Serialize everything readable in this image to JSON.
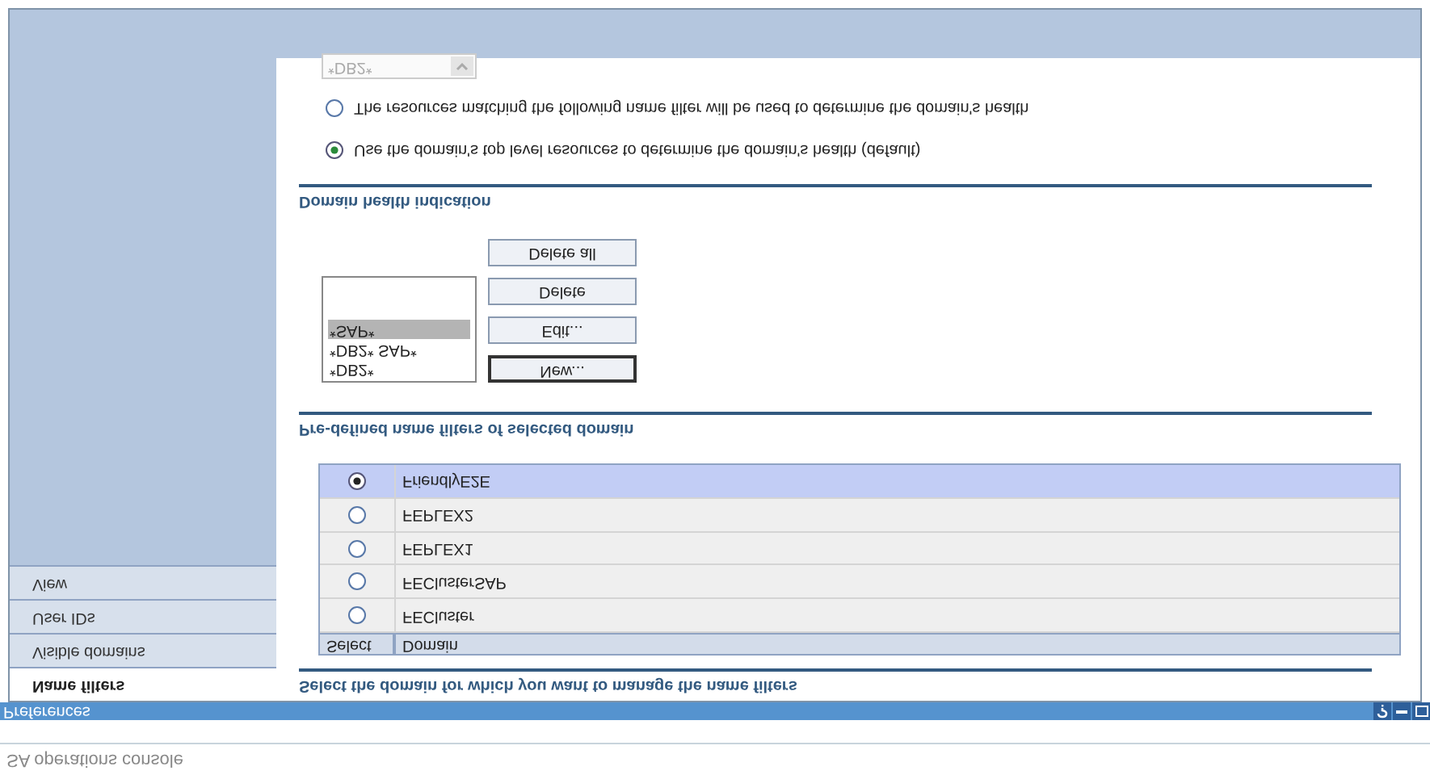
{
  "health_section": {
    "filter_combo": {
      "value": "*DB2*",
      "disabled": true
    },
    "options": [
      {
        "label": "The resources matching the following name filter will be used to determine the domain's health",
        "selected": false
      },
      {
        "label": "Use the domain's top level resources to determine the domain's health (default)",
        "selected": true
      }
    ],
    "heading": "Domain health indication"
  },
  "filters_section": {
    "buttons": [
      {
        "label": "Delete all",
        "focused": false
      },
      {
        "label": "Delete",
        "focused": false
      },
      {
        "label": "Edit...",
        "focused": false
      },
      {
        "label": "New...",
        "focused": true
      }
    ],
    "filters": [
      {
        "label": "*SAP*",
        "selected": true
      },
      {
        "label": "*DB2* SAP*",
        "selected": false
      },
      {
        "label": "*DB2*",
        "selected": false
      }
    ],
    "heading": "Pre-defined name filters of selected domain"
  },
  "domain_section": {
    "table": {
      "rows": [
        {
          "domain": "FriendlyE2E",
          "selected": true
        },
        {
          "domain": "FEPLEX2",
          "selected": false
        },
        {
          "domain": "FEPLEX1",
          "selected": false
        },
        {
          "domain": "FEClusterSAP",
          "selected": false
        },
        {
          "domain": "FECluster",
          "selected": false
        }
      ],
      "columns": [
        "Select",
        "Domain"
      ]
    },
    "heading": "Select the domain for which you want to manage the name filters"
  },
  "sidebar": {
    "items": [
      {
        "label": "View",
        "selected": false
      },
      {
        "label": "User IDs",
        "selected": false
      },
      {
        "label": "Visible domains",
        "selected": false
      },
      {
        "label": "Name filters",
        "selected": true
      }
    ]
  },
  "window": {
    "title": "Preferences"
  },
  "app_title": "SA operations console"
}
